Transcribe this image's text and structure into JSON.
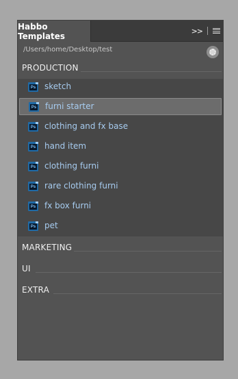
{
  "tab": {
    "title": "Habbo Templates"
  },
  "controls": {
    "expand_icon": "double-chevron-right-icon",
    "menu_icon": "hamburger-menu-icon"
  },
  "path": "/Users/home/Desktop/test",
  "sections": [
    {
      "label": "PRODUCTION"
    },
    {
      "label": "MARKETING"
    },
    {
      "label": "UI"
    },
    {
      "label": "EXTRA"
    }
  ],
  "items": [
    {
      "label": "sketch",
      "icon": "photoshop-file-icon",
      "icon_text": "Ps"
    },
    {
      "label": "furni starter",
      "icon": "photoshop-file-icon",
      "icon_text": "Ps",
      "selected": true
    },
    {
      "label": "clothing and fx base",
      "icon": "photoshop-file-icon",
      "icon_text": "Ps"
    },
    {
      "label": "hand item",
      "icon": "photoshop-file-icon",
      "icon_text": "Ps"
    },
    {
      "label": "clothing furni",
      "icon": "photoshop-file-icon",
      "icon_text": "Ps"
    },
    {
      "label": "rare clothing furni",
      "icon": "photoshop-file-icon",
      "icon_text": "Ps"
    },
    {
      "label": "fx box furni",
      "icon": "photoshop-file-icon",
      "icon_text": "Ps"
    },
    {
      "label": "pet",
      "icon": "photoshop-file-icon",
      "icon_text": "Ps"
    }
  ],
  "colors": {
    "accent_text": "#a7ccf0",
    "panel_bg": "#535353",
    "selected_bg": "#6c6c6c"
  }
}
